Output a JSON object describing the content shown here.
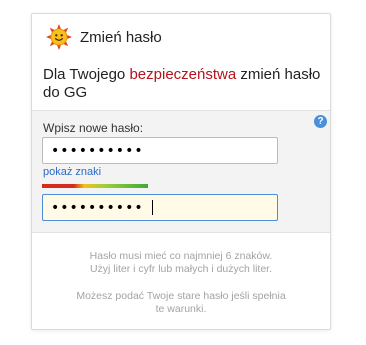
{
  "dialog": {
    "title": "Zmień hasło",
    "logo": "gg-sun-logo",
    "intro": {
      "before": "Dla Twojego ",
      "highlight": "bezpieczeństwa",
      "after": " zmień hasło do GG",
      "highlight_color": "#b4141b"
    }
  },
  "form": {
    "label": "Wpisz nowe hasło:",
    "password_value": "••••••••••",
    "show_password_link": "pokaż znaki",
    "confirm_value": "••••••••••",
    "strength_level": 1.0,
    "help_icon": "?"
  },
  "hints": {
    "line1": "Hasło musi mieć co najmniej 6 znaków.",
    "line2": "Użyj liter i cyfr lub małych i dużych liter.",
    "line3": "Możesz podać Twoje stare hasło jeśli spełnia",
    "line4": "te warunki."
  }
}
